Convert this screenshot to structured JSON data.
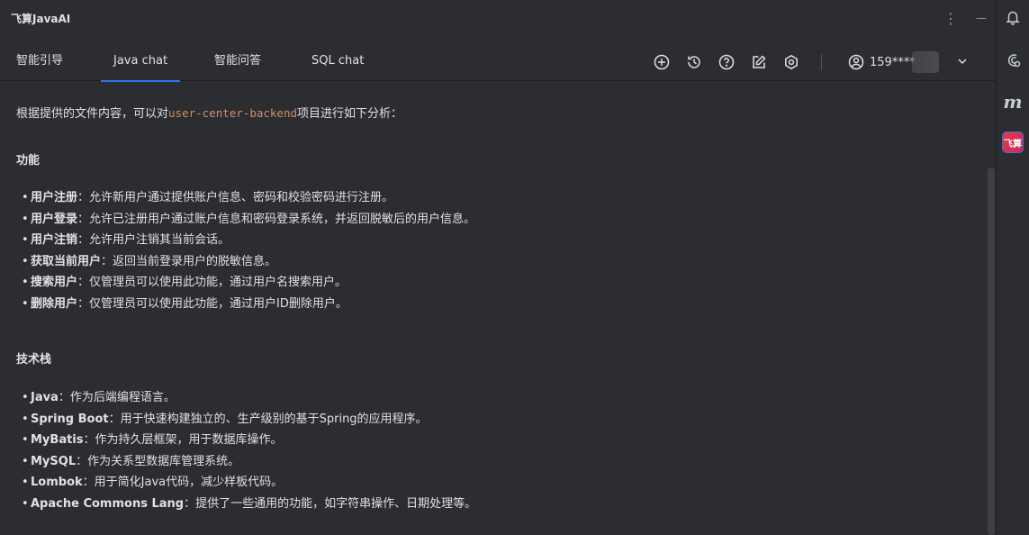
{
  "window": {
    "app_title": "飞算JavaAI",
    "more_icon": "⋮",
    "minimize_icon": "—"
  },
  "tabs": [
    {
      "label": "智能引导",
      "active": false
    },
    {
      "label": "Java chat",
      "active": true
    },
    {
      "label": "智能问答",
      "active": false
    },
    {
      "label": "SQL chat",
      "active": false
    }
  ],
  "toolbar": {
    "icons": [
      "plus-circle-icon",
      "history-icon",
      "help-icon",
      "edit-icon",
      "settings-icon"
    ]
  },
  "user": {
    "name": "159****",
    "icon": "user-circle-icon"
  },
  "content": {
    "intro_before": "根据提供的文件内容，可以对",
    "intro_code": "user-center-backend",
    "intro_after": "项目进行如下分析：",
    "features_heading": "功能",
    "features": [
      {
        "term": "用户注册",
        "desc": "：允许新用户通过提供账户信息、密码和校验密码进行注册。"
      },
      {
        "term": "用户登录",
        "desc": "：允许已注册用户通过账户信息和密码登录系统，并返回脱敏后的用户信息。"
      },
      {
        "term": "用户注销",
        "desc": "：允许用户注销其当前会话。"
      },
      {
        "term": "获取当前用户",
        "desc": "：返回当前登录用户的脱敏信息。"
      },
      {
        "term": "搜索用户",
        "desc": "：仅管理员可以使用此功能，通过用户名搜索用户。"
      },
      {
        "term": "删除用户",
        "desc": "：仅管理员可以使用此功能，通过用户ID删除用户。"
      }
    ],
    "tech_heading": "技术栈",
    "tech": [
      {
        "term": "Java",
        "desc": "：作为后端编程语言。"
      },
      {
        "term": "Spring Boot",
        "desc": "：用于快速构建独立的、生产级别的基于Spring的应用程序。"
      },
      {
        "term": "MyBatis",
        "desc": "：作为持久层框架，用于数据库操作。"
      },
      {
        "term": "MySQL",
        "desc": "：作为关系型数据库管理系统。"
      },
      {
        "term": "Lombok",
        "desc": "：用于简化Java代码，减少样板代码。"
      },
      {
        "term": "Apache Commons Lang",
        "desc": "：提供了一些通用的功能，如字符串操作、日期处理等。"
      }
    ]
  },
  "side_strip": {
    "m_label": "m",
    "plugin_label": "飞算"
  },
  "colors": {
    "background": "#2b2d30",
    "text": "#dfe1e5",
    "accent": "#3574f0",
    "code": "#cf8e6d"
  }
}
